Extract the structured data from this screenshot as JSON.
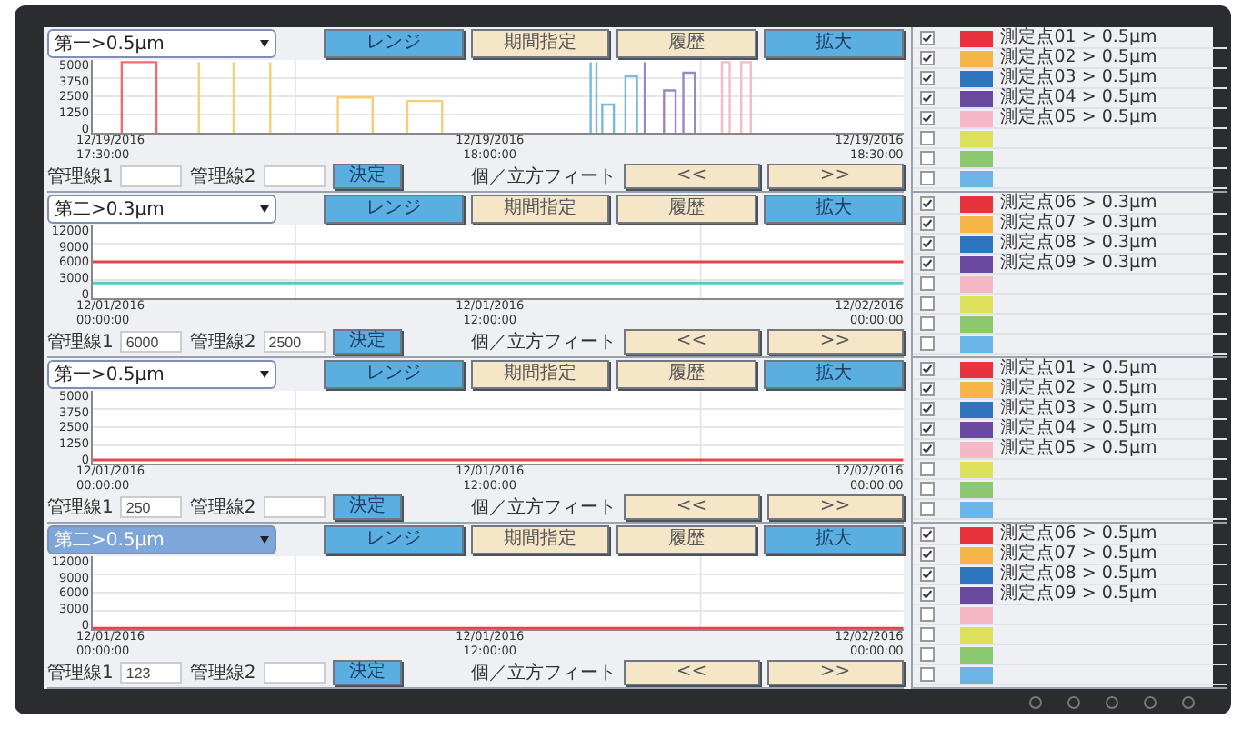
{
  "panels": [
    {
      "sensor": {
        "value": "第一>0.5μm",
        "selected": false
      },
      "buttons": [
        {
          "label": "レンジ",
          "active": true
        },
        {
          "label": "期間指定",
          "active": false
        },
        {
          "label": "履歴",
          "active": false
        },
        {
          "label": "拡大",
          "active": true
        }
      ],
      "kind": "pulses",
      "y_ticks": [
        "5000",
        "3750",
        "2500",
        "1250",
        "0"
      ],
      "x_labels": [
        {
          "date": "12/19/2016",
          "time": "17:30:00"
        },
        {
          "date": "12/19/2016",
          "time": "18:00:00"
        },
        {
          "date": "12/19/2016",
          "time": "18:30:00"
        }
      ],
      "control_1": {
        "label": "管理線1"
      },
      "control_2": {
        "label": "管理線2"
      },
      "apply": "決定",
      "unit": "個／立方フィート",
      "prev": "<<",
      "next": ">>"
    },
    {
      "sensor": {
        "value": "第二>0.3μm",
        "selected": false
      },
      "buttons": [
        {
          "label": "レンジ",
          "active": true
        },
        {
          "label": "期間指定",
          "active": false
        },
        {
          "label": "履歴",
          "active": false
        },
        {
          "label": "拡大",
          "active": true
        }
      ],
      "kind": "lines",
      "y_ticks": [
        "12000",
        "9000",
        "6000",
        "3000",
        "0"
      ],
      "x_labels": [
        {
          "date": "12/01/2016",
          "time": "00:00:00"
        },
        {
          "date": "12/01/2016",
          "time": "12:00:00"
        },
        {
          "date": "12/02/2016",
          "time": "00:00:00"
        }
      ],
      "control_1": {
        "label": "管理線1",
        "value": "6000"
      },
      "control_2": {
        "label": "管理線2",
        "value": "2500"
      },
      "apply": "決定",
      "unit": "個／立方フィート",
      "prev": "<<",
      "next": ">>"
    },
    {
      "sensor": {
        "value": "第一>0.5μm",
        "selected": false
      },
      "buttons": [
        {
          "label": "レンジ",
          "active": true
        },
        {
          "label": "期間指定",
          "active": false
        },
        {
          "label": "履歴",
          "active": false
        },
        {
          "label": "拡大",
          "active": true
        }
      ],
      "kind": "lines",
      "y_ticks": [
        "5000",
        "3750",
        "2500",
        "1250",
        "0"
      ],
      "x_labels": [
        {
          "date": "12/01/2016",
          "time": "00:00:00"
        },
        {
          "date": "12/01/2016",
          "time": "12:00:00"
        },
        {
          "date": "12/02/2016",
          "time": "00:00:00"
        }
      ],
      "control_1": {
        "label": "管理線1",
        "value": "250"
      },
      "control_2": {
        "label": "管理線2"
      },
      "apply": "決定",
      "unit": "個／立方フィート",
      "prev": "<<",
      "next": ">>"
    },
    {
      "sensor": {
        "value": "第二>0.5μm",
        "selected": true
      },
      "buttons": [
        {
          "label": "レンジ",
          "active": true
        },
        {
          "label": "期間指定",
          "active": false
        },
        {
          "label": "履歴",
          "active": false
        },
        {
          "label": "拡大",
          "active": true
        }
      ],
      "kind": "lines",
      "y_ticks": [
        "12000",
        "9000",
        "6000",
        "3000",
        "0"
      ],
      "x_labels": [
        {
          "date": "12/01/2016",
          "time": "00:00:00"
        },
        {
          "date": "12/01/2016",
          "time": "12:00:00"
        },
        {
          "date": "12/02/2016",
          "time": "00:00:00"
        }
      ],
      "control_1": {
        "label": "管理線1",
        "value": "123"
      },
      "control_2": {
        "label": "管理線2"
      },
      "apply": "決定",
      "unit": "個／立方フィート",
      "prev": "<<",
      "next": ">>"
    }
  ],
  "legend": [
    [
      {
        "checked": true,
        "color": "#e8323c",
        "label": "測定点01 > 0.5μm"
      },
      {
        "checked": true,
        "color": "#f7b548",
        "label": "測定点02 > 0.5μm"
      },
      {
        "checked": true,
        "color": "#2e74bf",
        "label": "測定点03 > 0.5μm"
      },
      {
        "checked": true,
        "color": "#6a4a9e",
        "label": "測定点04 > 0.5μm"
      },
      {
        "checked": true,
        "color": "#f5b8c6",
        "label": "測定点05 > 0.5μm"
      },
      {
        "checked": false,
        "color": "#dde05a"
      },
      {
        "checked": false,
        "color": "#8cc870"
      },
      {
        "checked": false,
        "color": "#6ab4e6"
      }
    ],
    [
      {
        "checked": true,
        "color": "#e8323c",
        "label": "測定点06 > 0.3μm"
      },
      {
        "checked": true,
        "color": "#f7b548",
        "label": "測定点07 > 0.3μm"
      },
      {
        "checked": true,
        "color": "#2e74bf",
        "label": "測定点08 > 0.3μm"
      },
      {
        "checked": true,
        "color": "#6a4a9e",
        "label": "測定点09 > 0.3μm"
      },
      {
        "checked": false,
        "color": "#f5b8c6"
      },
      {
        "checked": false,
        "color": "#dde05a"
      },
      {
        "checked": false,
        "color": "#8cc870"
      },
      {
        "checked": false,
        "color": "#6ab4e6"
      }
    ],
    [
      {
        "checked": true,
        "color": "#e8323c",
        "label": "測定点01 > 0.5μm"
      },
      {
        "checked": true,
        "color": "#f7b548",
        "label": "測定点02 > 0.5μm"
      },
      {
        "checked": true,
        "color": "#2e74bf",
        "label": "測定点03 > 0.5μm"
      },
      {
        "checked": true,
        "color": "#6a4a9e",
        "label": "測定点04 > 0.5μm"
      },
      {
        "checked": true,
        "color": "#f5b8c6",
        "label": "測定点05 > 0.5μm"
      },
      {
        "checked": false,
        "color": "#dde05a"
      },
      {
        "checked": false,
        "color": "#8cc870"
      },
      {
        "checked": false,
        "color": "#6ab4e6"
      }
    ],
    [
      {
        "checked": true,
        "color": "#e8323c",
        "label": "測定点06 > 0.5μm"
      },
      {
        "checked": true,
        "color": "#f7b548",
        "label": "測定点07 > 0.5μm"
      },
      {
        "checked": true,
        "color": "#2e74bf",
        "label": "測定点08 > 0.5μm"
      },
      {
        "checked": true,
        "color": "#6a4a9e",
        "label": "測定点09 > 0.5μm"
      },
      {
        "checked": false,
        "color": "#f5b8c6"
      },
      {
        "checked": false,
        "color": "#dde05a"
      },
      {
        "checked": false,
        "color": "#8cc870"
      },
      {
        "checked": false,
        "color": "#6ab4e6"
      }
    ]
  ]
}
